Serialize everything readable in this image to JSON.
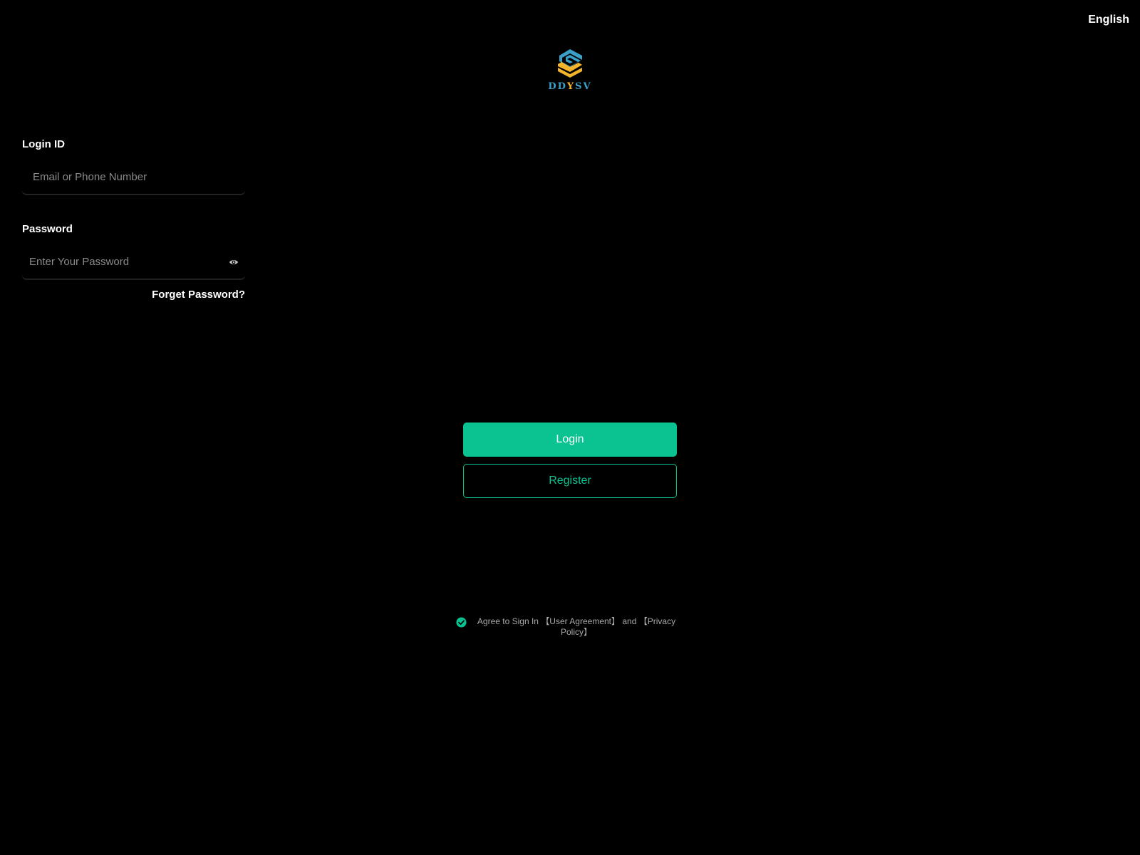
{
  "header": {
    "language": "English"
  },
  "logo": {
    "text_a": "DD",
    "text_y": "Y",
    "text_b": "SV"
  },
  "form": {
    "login_id": {
      "label": "Login ID",
      "placeholder": "Email or Phone Number",
      "value": ""
    },
    "password": {
      "label": "Password",
      "placeholder": "Enter Your Password",
      "value": ""
    },
    "forgot_label": "Forget Password?"
  },
  "actions": {
    "login_label": "Login",
    "register_label": "Register"
  },
  "agreement": {
    "prefix": "Agree to Sign In ",
    "user_agreement": "【User Agreement】",
    "and": "and",
    "privacy_policy": "【Privacy Policy】"
  },
  "colors": {
    "accent": "#0ac391",
    "background": "#000000",
    "logo_blue": "#3aa0c8",
    "logo_yellow": "#f3b32a"
  },
  "icons": {
    "logo": "ddysv-logo-icon",
    "password_toggle": "eye-icon",
    "agreement_check": "check-circle-icon"
  }
}
